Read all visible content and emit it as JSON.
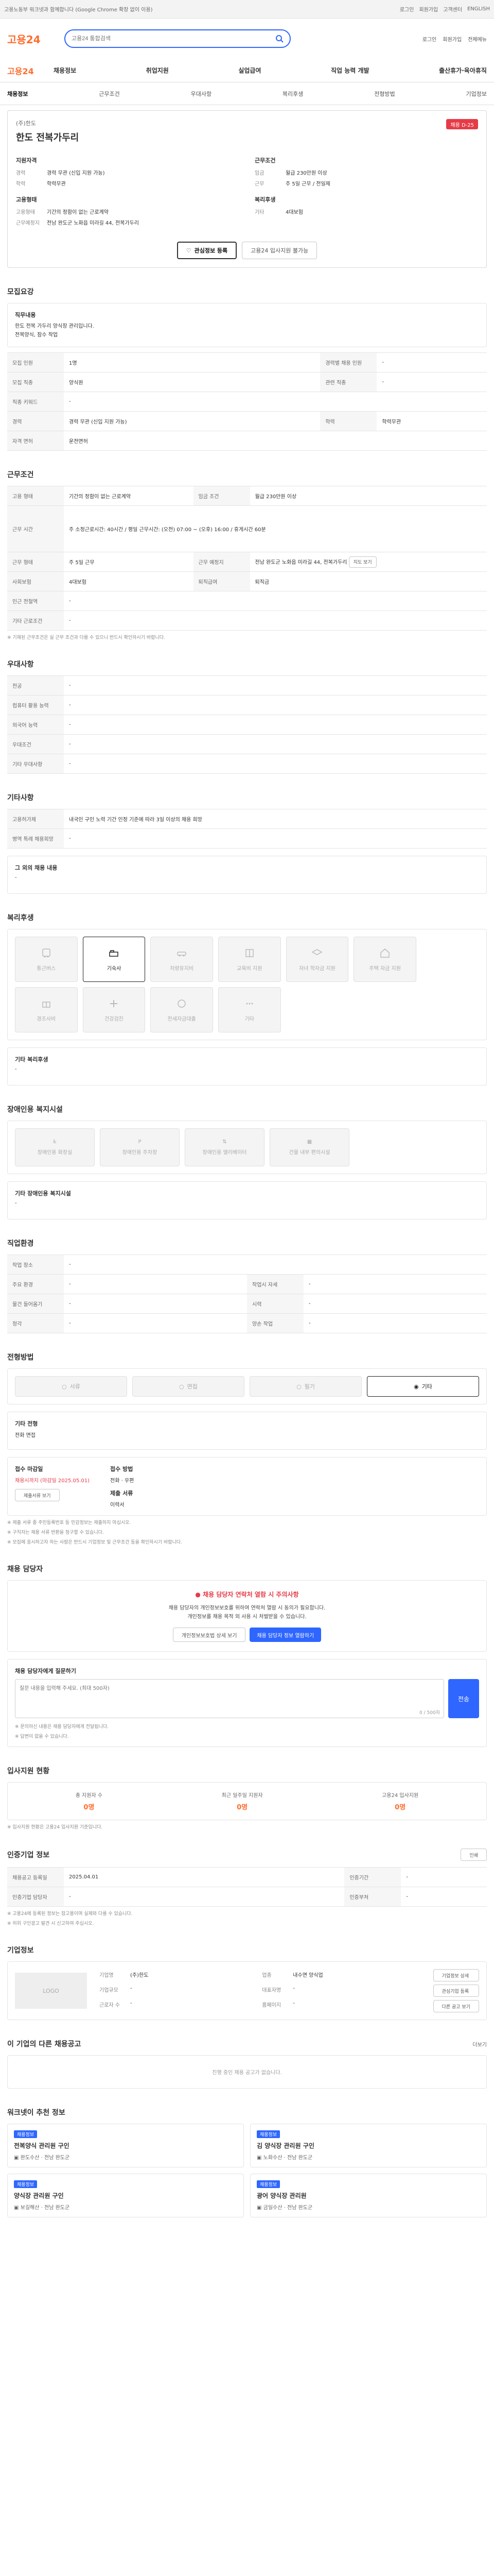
{
  "topbar": {
    "notice": "고용노동부 워크넷과 함께합니다 (Google Chrome 확장 없이 이용)",
    "links": [
      "로그인",
      "회원가입",
      "고객센터",
      "ENGLISH"
    ]
  },
  "header": {
    "logo": "고용24",
    "search_placeholder": "고용24 통합검색",
    "right": [
      "로그인",
      "회원가입",
      "전체메뉴"
    ]
  },
  "gnb": {
    "brand": "고용24",
    "items": [
      "채용정보",
      "취업지원",
      "실업급여",
      "직업 능력 개발",
      "출산휴가·육아휴직"
    ]
  },
  "tabs": {
    "items": [
      "채용정보",
      "근무조건",
      "우대사항",
      "복리후생",
      "전형방법",
      "기업정보"
    ],
    "active": 0
  },
  "job": {
    "company": "(주)한도",
    "title": "한도 전복가두리",
    "badge": "채용 D-25",
    "left_sections": [
      {
        "heading": "지원자격",
        "rows": [
          [
            "경력",
            "경력 무관 (신입 지원 가능)"
          ],
          [
            "학력",
            "학력무관"
          ]
        ]
      },
      {
        "heading": "고용형태",
        "rows": [
          [
            "고용형태",
            "기간의 정함이 없는 근로계약"
          ],
          [
            "근무예정지",
            "전남 완도군 노화읍 미라길 44, 전복가두리"
          ]
        ]
      }
    ],
    "right_sections": [
      {
        "heading": "근무조건",
        "rows": [
          [
            "임금",
            "월급 230만원 이상"
          ],
          [
            "근무",
            "주 5일 근무 / 전일제"
          ]
        ]
      },
      {
        "heading": "복리후생",
        "rows": [
          [
            "기타",
            "4대보험"
          ]
        ]
      }
    ],
    "btn_scrap": "관심정보 등록",
    "btn_apply": "고용24 입사지원 불가능"
  },
  "recruit": {
    "title": "모집요강",
    "duty_heading": "직무내용",
    "duty_lines": [
      "한도 전복 가두리 양식장 관리입니다.",
      "전복양식, 잠수 작업"
    ],
    "rows": [
      [
        "모집 인원",
        "1명",
        "경력별 채용 인원",
        "-"
      ],
      [
        "모집 직종",
        "양식원",
        "관련 직종",
        "-"
      ],
      [
        "직종 키워드",
        "-",
        "",
        ""
      ],
      [
        "경력",
        "경력 무관 (신입 지원 가능)",
        "학력",
        "학력무관"
      ],
      [
        "자격 면허",
        "운전면허",
        "",
        ""
      ]
    ]
  },
  "conditions": {
    "title": "근무조건",
    "rows": [
      [
        "고용 형태",
        "기간의 정함이 없는 근로계약",
        "임금 조건",
        "월급 230만원 이상"
      ],
      [
        "근무 시간",
        "주 소정근로시간: 40시간 / 평일 근무시간: (오전) 07:00 ~ (오후) 16:00 / 휴게시간 60분",
        "",
        ""
      ],
      [
        "근무 형태",
        "주 5일 근무",
        "근무 예정지",
        "전남 완도군 노화읍 미라길 44, 전복가두리"
      ],
      [
        "사회보험",
        "4대보험",
        "퇴직급여",
        "퇴직금"
      ]
    ],
    "location_btn": "지도 보기",
    "extra_rows": [
      [
        "인근 전철역",
        "-"
      ],
      [
        "기타 근로조건",
        "-"
      ]
    ],
    "note": "※ 기재된 근무조건은 실 근무 조건과 다를 수 있으니 반드시 확인하시기 바랍니다."
  },
  "preferences": {
    "title": "우대사항",
    "rows": [
      [
        "전공",
        "-"
      ],
      [
        "컴퓨터 활용 능력",
        "-"
      ],
      [
        "외국어 능력",
        "-"
      ],
      [
        "우대조건",
        "-"
      ],
      [
        "기타 우대사항",
        "-"
      ]
    ]
  },
  "etc": {
    "title": "기타사항",
    "rows": [
      [
        "고용허가제",
        "내국인 구인 노력 기간 인정 기준에 따라 3일 이상의 채용 희망"
      ],
      [
        "병역 특례 채용희망",
        "-"
      ]
    ],
    "other_heading": "그 외의 채용 내용",
    "other_value": "-"
  },
  "welfare": {
    "title": "복리후생",
    "items": [
      {
        "label": "통근버스",
        "icon": "bus-icon",
        "on": false
      },
      {
        "label": "기숙사",
        "icon": "dormitory-icon",
        "on": true
      },
      {
        "label": "차량유지비",
        "icon": "car-icon",
        "on": false
      },
      {
        "label": "교육비 지원",
        "icon": "book-icon",
        "on": false
      },
      {
        "label": "자녀 학자금 지원",
        "icon": "graduation-icon",
        "on": false
      },
      {
        "label": "주택 자금 지원",
        "icon": "house-icon",
        "on": false
      },
      {
        "label": "경조사비",
        "icon": "gift-icon",
        "on": false
      },
      {
        "label": "건강검진",
        "icon": "health-icon",
        "on": false
      },
      {
        "label": "전세자금대출",
        "icon": "money-icon",
        "on": false
      },
      {
        "label": "기타",
        "icon": "more-icon",
        "on": false
      }
    ],
    "extra_heading": "기타 복리후생",
    "extra_value": "-"
  },
  "disability": {
    "title": "장애인용 복지시설",
    "items": [
      "장애인용 화장실",
      "장애인용 주차장",
      "장애인용 엘리베이터",
      "건물 내부 편의시설"
    ],
    "extra_heading": "기타 장애인용 복지시설",
    "extra_value": "-"
  },
  "process": {
    "title": "직업환경",
    "rows": [
      [
        "작업 장소",
        "-",
        "",
        ""
      ],
      [
        "주요 환경",
        "-",
        "작업시 자세",
        "-"
      ],
      [
        "물건 들어옴기",
        "-",
        "시력",
        "-"
      ],
      [
        "청각",
        "-",
        "양손 작업",
        "-"
      ]
    ]
  },
  "selection": {
    "title": "전형방법",
    "methods": [
      {
        "label": "서류",
        "on": false
      },
      {
        "label": "면접",
        "on": false
      },
      {
        "label": "필기",
        "on": false
      },
      {
        "label": "기타",
        "on": true
      }
    ],
    "method_heading": "기타 전형",
    "method_value": "전화 면접",
    "docs_heading": "접수 마감일",
    "docs_value": "채용시까지 (마감일 2025.05.01)",
    "way_heading": "접수 방법",
    "way_value": "전화 · 우편",
    "docs2_heading": "제출 서류",
    "docs2_value": "이력서",
    "list_btn": "제출서류 보기",
    "notes": [
      "※ 제출 서류 중 주민등록번호 등 민감정보는 제출하지 마십시오.",
      "※ 구직자는 채용 서류 반환을 청구할 수 있습니다.",
      "※ 모집에 응시하고자 하는 사람은 반드시 기업정보 및 근무조건 등을 확인하시기 바랍니다."
    ]
  },
  "contact": {
    "title": "채용 담당자",
    "warn_title": "채용 담당자 연락처 열람 시 주의사항",
    "warn_lines": [
      "채용 담당자의 개인정보보호를 위하여 연락처 열람 시 동의가 필요합니다.",
      "개인정보를 채용 목적 외 사용 시 처벌받을 수 있습니다."
    ],
    "btn_detail": "개인정보보호법 상세 보기",
    "btn_view": "채용 담당자 정보 열람하기",
    "ask_heading": "채용 담당자에게 질문하기",
    "ask_placeholder": "질문 내용을 입력해 주세요. (최대 500자)",
    "ask_count": "0 / 500자",
    "ask_btn": "전송",
    "ask_notes": [
      "※ 문의하신 내용은 채용 담당자에게 전달됩니다.",
      "※ 답변이 없을 수 있습니다."
    ]
  },
  "applicants": {
    "title": "입사지원 현황",
    "stats": [
      [
        "총 지원자 수",
        "0명"
      ],
      [
        "최근 일주일 지원자",
        "0명"
      ],
      [
        "고용24 입사지원",
        "0명"
      ]
    ],
    "note": "※ 입사지원 현황은 고용24 입사지원 기준입니다."
  },
  "info": {
    "title": "인증기업 정보",
    "print_btn": "인쇄",
    "rows": [
      [
        "채용공고 등록일",
        "2025.04.01",
        "인증기간",
        "-"
      ],
      [
        "인증기업 담당자",
        "-",
        "인증부처",
        "-"
      ]
    ],
    "notes": [
      "※ 고용24에 등록된 정보는 참고용이며 실제와 다를 수 있습니다.",
      "※ 허위 구인광고 발견 시 신고하여 주십시오."
    ]
  },
  "company": {
    "title": "기업정보",
    "logo_text": "LOGO",
    "fields": [
      [
        "기업명",
        "(주)한도"
      ],
      [
        "업종",
        "내수면 양식업"
      ],
      [
        "기업규모",
        "-"
      ],
      [
        "대표자명",
        "-"
      ],
      [
        "근로자 수",
        "-"
      ],
      [
        "홈페이지",
        "-"
      ]
    ],
    "btn_detail": "기업정보 상세",
    "btn_scrap": "관심기업 등록",
    "btn_more": "다른 공고 보기"
  },
  "others": {
    "title": "이 기업의 다른 채용공고",
    "empty": "진행 중인 채용 공고가 없습니다.",
    "more": "더보기"
  },
  "recommend": {
    "title": "워크넷이 추천 정보",
    "items": [
      {
        "tag": "채용정보",
        "title": "전복양식 관리원 구인",
        "company": "완도수산",
        "place": "전남 완도군"
      },
      {
        "tag": "채용정보",
        "title": "김 양식장 관리원 구인",
        "company": "노화수산",
        "place": "전남 완도군"
      },
      {
        "tag": "채용정보",
        "title": "양식장 관리원 구인",
        "company": "보길해산",
        "place": "전남 완도군"
      },
      {
        "tag": "채용정보",
        "title": "광어 양식장 관리원",
        "company": "금일수산",
        "place": "전남 완도군"
      }
    ]
  }
}
